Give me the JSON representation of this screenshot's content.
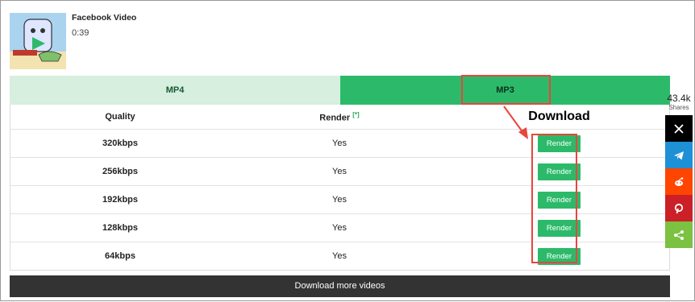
{
  "video": {
    "title": "Facebook Video",
    "duration": "0:39"
  },
  "tabs": [
    {
      "label": "MP4"
    },
    {
      "label": "MP3"
    }
  ],
  "table": {
    "headers": {
      "quality": "Quality",
      "render": "Render",
      "render_note": "[*]",
      "download": "Download"
    },
    "rows": [
      {
        "quality": "320kbps",
        "render": "Yes",
        "button": "Render"
      },
      {
        "quality": "256kbps",
        "render": "Yes",
        "button": "Render"
      },
      {
        "quality": "192kbps",
        "render": "Yes",
        "button": "Render"
      },
      {
        "quality": "128kbps",
        "render": "Yes",
        "button": "Render"
      },
      {
        "quality": "64kbps",
        "render": "Yes",
        "button": "Render"
      }
    ]
  },
  "more_button": "Download more videos",
  "share": {
    "count": "43.4k",
    "label": "Shares",
    "buttons": [
      {
        "icon": "x-icon",
        "color": "#000000"
      },
      {
        "icon": "telegram-icon",
        "color": "#1e90d6"
      },
      {
        "icon": "reddit-icon",
        "color": "#ff4500"
      },
      {
        "icon": "pinterest-icon",
        "color": "#cb2027"
      },
      {
        "icon": "share-icon",
        "color": "#7bc142"
      }
    ]
  },
  "colors": {
    "accent": "#2cba6a",
    "tab_inactive": "#d6efdf",
    "highlight": "#e8453c",
    "bar": "#333333"
  }
}
